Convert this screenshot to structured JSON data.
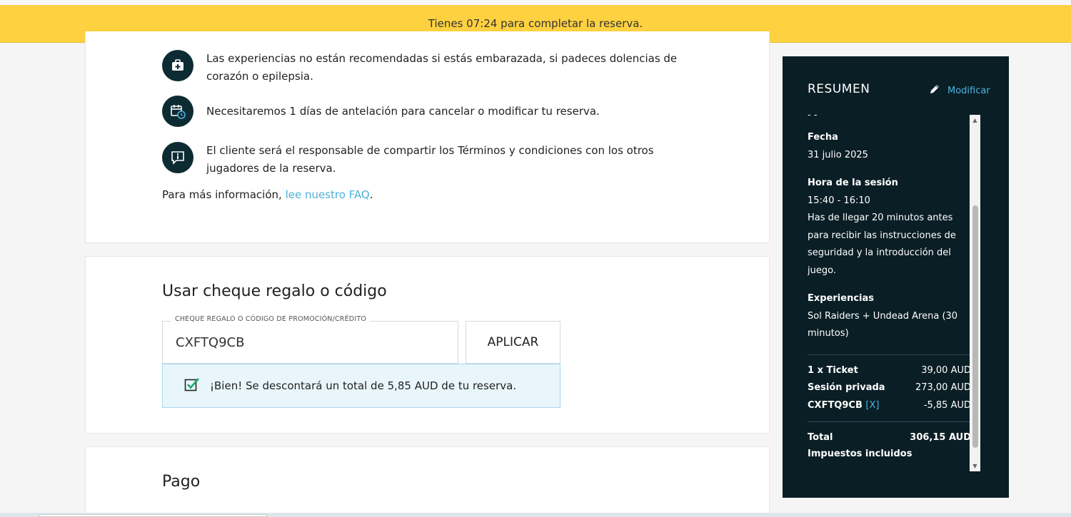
{
  "timer": {
    "text": "Tienes 07:24 para completar la reserva."
  },
  "info": {
    "items": [
      {
        "icon": "first-aid-kit-icon",
        "text": "Las experiencias no están recomendadas si estás embarazada, si padeces dolencias de corazón o epilepsia."
      },
      {
        "icon": "calendar-clock-icon",
        "text": "Necesitaremos 1 días de antelación para cancelar o modificar tu reserva."
      },
      {
        "icon": "info-message-icon",
        "text": "El cliente será el responsable de compartir los Términos y condiciones con los otros jugadores de la reserva."
      }
    ],
    "faq_prefix": "Para más información, ",
    "faq_link": "lee nuestro FAQ",
    "faq_suffix": "."
  },
  "coupon": {
    "title": "Usar cheque regalo o código",
    "field_label": "CHEQUE REGALO O CÓDIGO DE PROMOCIÓN/CRÉDITO",
    "value": "CXFTQ9CB",
    "apply_label": "APLICAR",
    "success_text": "¡Bien! Se descontará un total de 5,85 AUD de tu reserva."
  },
  "payment": {
    "title": "Pago"
  },
  "summary": {
    "title": "RESUMEN",
    "modify_label": "Modificar",
    "cut_text": "- -",
    "date_label": "Fecha",
    "date_value": "31 julio 2025",
    "session_label": "Hora de la sesión",
    "session_time": "15:40 - 16:10",
    "session_note": "Has de llegar 20 minutos antes para recibir las instrucciones de seguridad y la introducción del juego.",
    "experiences_label": "Experiencias",
    "experiences_value": "Sol Raiders + Undead Arena (30 minutos)",
    "lines": [
      {
        "label": "1 x Ticket",
        "value": "39,00 AUD"
      },
      {
        "label": "Sesión privada",
        "value": "273,00 AUD"
      }
    ],
    "discount": {
      "code": "CXFTQ9CB",
      "remove": "[X]",
      "value": "-5,85 AUD"
    },
    "total_label": "Total",
    "total_value": "306,15 AUD",
    "taxes_note": "Impuestos incluidos"
  },
  "colors": {
    "timer_bg": "#fdd140",
    "sidebar_bg": "#0a1e25",
    "accent": "#49b4e0",
    "success_bg": "#e8f6fc",
    "success_check": "#1fa868"
  }
}
